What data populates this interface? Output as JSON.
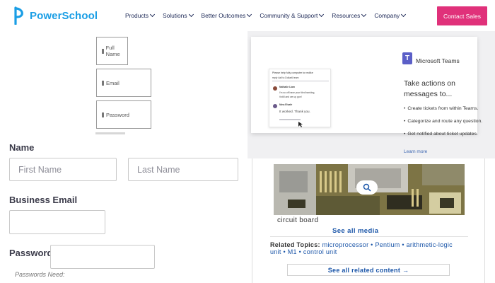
{
  "header": {
    "logo_text": "PowerSchool",
    "nav": [
      {
        "label": "Products"
      },
      {
        "label": "Solutions"
      },
      {
        "label": "Better Outcomes"
      },
      {
        "label": "Community & Support"
      },
      {
        "label": "Resources"
      },
      {
        "label": "Company"
      }
    ],
    "contact_label": "Contact Sales",
    "accent_color": "#e0317a",
    "brand_color": "#1a9ee5"
  },
  "mini_form": {
    "full_name_placeholder": "Full Name",
    "email_placeholder": "Email",
    "password_placeholder": "Password"
  },
  "signup_form": {
    "name_label": "Name",
    "first_name_placeholder": "First Name",
    "last_name_placeholder": "Last Name",
    "email_label": "Business Email",
    "email_value": "",
    "password_label": "Password",
    "password_value": "",
    "password_hint": "Passwords Need:"
  },
  "teams_promo": {
    "brand": "Microsoft Teams",
    "title": "Take actions on messages to...",
    "bullets": [
      "Create tickets from within Teams.",
      "Categorize and route any question.",
      "Get notified about ticket updates."
    ],
    "learn_more": "Learn more",
    "chat": {
      "header": "Please help fully computer to reolike",
      "sub": "reply 4all to Dollar6 team",
      "m1_name": "Nathalie Liam",
      "m1_text1": "I'm so off have your tiled banking,",
      "m1_text2": "it still and we up gon!",
      "m2_name": "Nina Elsafe",
      "m2_text": "It worked. Thank you."
    }
  },
  "media": {
    "caption": "circuit board",
    "see_all_media": "See all media",
    "related_label": "Related Topics:",
    "related_links": "microprocessor • Pentium • arithmetic-logic unit • M1 • control unit",
    "see_all_related": "See all related content →"
  }
}
